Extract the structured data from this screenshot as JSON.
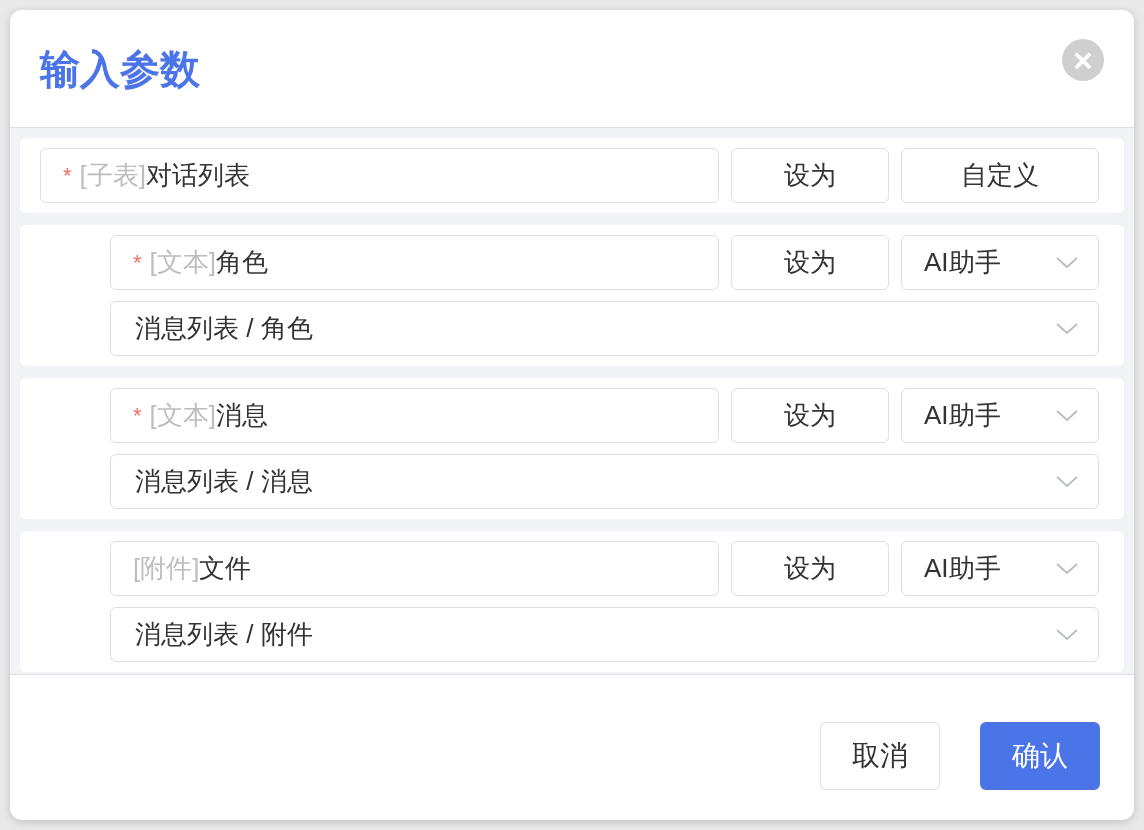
{
  "dialog": {
    "title": "输入参数",
    "close": "×"
  },
  "params": [
    {
      "required_mark": "*",
      "type_tag": "[子表]",
      "name": "对话列表",
      "set_label": "设为",
      "mode": {
        "kind": "button",
        "label": "自定义"
      },
      "children": [
        {
          "required_mark": "*",
          "type_tag": "[文本]",
          "name": "角色",
          "set_label": "设为",
          "mode": {
            "kind": "select",
            "label": "AI助手"
          },
          "source": "消息列表 / 角色"
        },
        {
          "required_mark": "*",
          "type_tag": "[文本]",
          "name": "消息",
          "set_label": "设为",
          "mode": {
            "kind": "select",
            "label": "AI助手"
          },
          "source": "消息列表 / 消息"
        },
        {
          "type_tag": "[附件]",
          "name": "文件",
          "set_label": "设为",
          "mode": {
            "kind": "select",
            "label": "AI助手"
          },
          "source": "消息列表 / 附件"
        }
      ]
    }
  ],
  "footer": {
    "cancel": "取消",
    "confirm": "确认"
  }
}
